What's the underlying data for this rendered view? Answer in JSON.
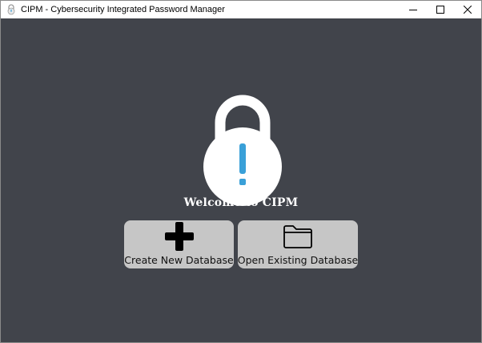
{
  "window": {
    "title": "CIPM - Cybersecurity Integrated Password Manager"
  },
  "main": {
    "welcome_text": "Welcome to CIPM",
    "buttons": [
      {
        "label": "Create New Database",
        "icon": "plus-icon"
      },
      {
        "label": "Open Existing Database",
        "icon": "folder-icon"
      }
    ]
  },
  "colors": {
    "background": "#41444b",
    "button_bg": "#c6c6c6",
    "lock_body": "#ffffff",
    "exclamation": "#3aa0d8"
  }
}
